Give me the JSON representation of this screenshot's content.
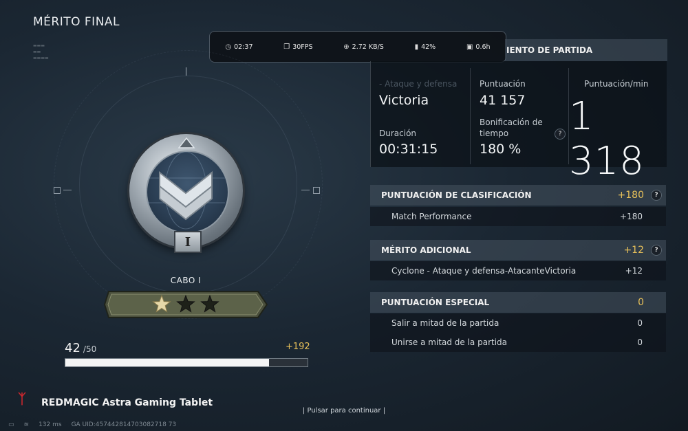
{
  "screen": {
    "title": "MÉRITO FINAL"
  },
  "perf_overlay": {
    "time": "02:37",
    "fps": "30FPS",
    "network": "2.72 KB/S",
    "battery": "42%",
    "usage": "0.6h"
  },
  "rank": {
    "name": "CABO I",
    "numeral": "I",
    "stars_total": 3,
    "stars_filled": 1,
    "xp_current": "42",
    "xp_max": "/50",
    "xp_progress": 0.84,
    "xp_gain": "+192"
  },
  "summary": {
    "header": "IENTO DE PARTIDA",
    "mode_faint": "- Ataque y defensa",
    "result": "Victoria",
    "duration_label": "Duración",
    "duration": "00:31:15",
    "score_label": "Puntuación",
    "score": "41 157",
    "time_bonus_label_1": "Bonificación de",
    "time_bonus_label_2": "tiempo",
    "time_bonus": "180 %",
    "score_per_min_label": "Puntuación/min",
    "score_per_min": "1 318"
  },
  "sections": [
    {
      "title": "PUNTUACIÓN DE CLASIFICACIÓN",
      "amount": "+180",
      "help": "?",
      "rows": [
        {
          "label": "Match Performance",
          "value": "+180"
        }
      ]
    },
    {
      "title": "MÉRITO ADICIONAL",
      "amount": "+12",
      "help": "?",
      "rows": [
        {
          "label": "Cyclone - Ataque y defensa-AtacanteVictoria",
          "value": "+12"
        }
      ]
    },
    {
      "title": "PUNTUACIÓN ESPECIAL",
      "amount": "0",
      "rows": [
        {
          "label": "Salir a mitad de la partida",
          "value": "0"
        },
        {
          "label": "Unirse a mitad de la partida",
          "value": "0"
        }
      ]
    }
  ],
  "footer": {
    "continue": "Pulsar para continuar",
    "brand": "REDMAGIC Astra Gaming Tablet",
    "ping": "132 ms",
    "uid": "GA UID:457442814703082718 73"
  },
  "colors": {
    "accent_gold": "#e8c15a",
    "brand_red": "#c9272e"
  }
}
